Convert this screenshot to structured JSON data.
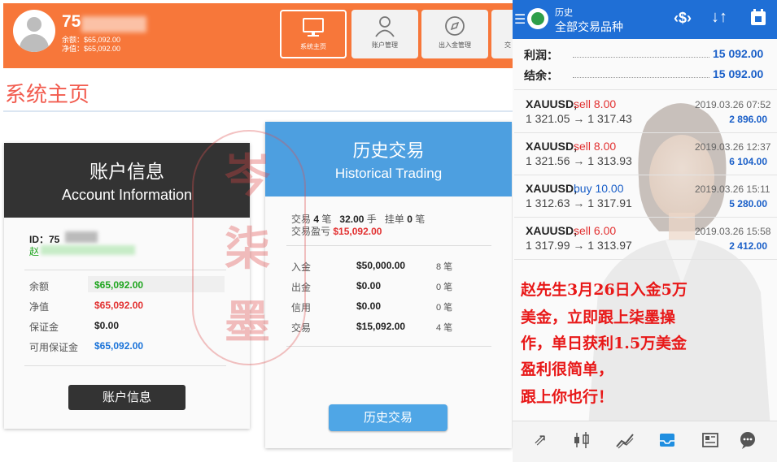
{
  "web": {
    "account": {
      "id_prefix": "75",
      "balance_line": "余额：$65,092.00",
      "equity_line": "净值：$65,092.00"
    },
    "nav": [
      {
        "label": "系统主页",
        "icon": "monitor-icon",
        "active": true
      },
      {
        "label": "账户管理",
        "icon": "user-icon",
        "active": false
      },
      {
        "label": "出入金管理",
        "icon": "compass-icon",
        "active": false
      },
      {
        "label": "交",
        "icon": "list-icon",
        "active": false
      }
    ],
    "page_title": "系统主页",
    "account_card": {
      "title_zh": "账户信息",
      "title_en": "Account Information",
      "id_label": "ID：75",
      "name_prefix": "赵",
      "rows": [
        {
          "label": "余额",
          "value": "$65,092.00",
          "color": "#1fa51f"
        },
        {
          "label": "净值",
          "value": "$65,092.00",
          "color": "#e23030"
        },
        {
          "label": "保证金",
          "value": "$0.00",
          "color": "#222222"
        },
        {
          "label": "可用保证金",
          "value": "$65,092.00",
          "color": "#1a73d9"
        }
      ],
      "button": "账户信息"
    },
    "history_card": {
      "title_zh": "历史交易",
      "title_en": "Historical Trading",
      "summary": {
        "trades_label": "交易",
        "trades_value": "4",
        "trades_unit": "笔",
        "lots_value": "32.00",
        "lots_unit": "手",
        "pending_label": "挂单",
        "pending_value": "0",
        "pending_unit": "笔",
        "pl_label": "交易盈亏",
        "pl_value": "$15,092.00"
      },
      "rows": [
        {
          "label": "入金",
          "value": "$50,000.00",
          "count": "8 笔"
        },
        {
          "label": "出金",
          "value": "$0.00",
          "count": "0 笔"
        },
        {
          "label": "信用",
          "value": "$0.00",
          "count": "0 笔"
        },
        {
          "label": "交易",
          "value": "$15,092.00",
          "count": "4 笔"
        }
      ],
      "button": "历史交易"
    },
    "stamp_text": [
      "岑",
      "柒",
      "墨"
    ]
  },
  "mobile": {
    "header": {
      "title": "历史",
      "subtitle": "全部交易品种"
    },
    "summary": [
      {
        "label": "利润：",
        "value": "15 092.00"
      },
      {
        "label": "结余：",
        "value": "15 092.00"
      }
    ],
    "trades": [
      {
        "symbol": "XAUUSD,",
        "side": "sell 8.00",
        "side_color": "#e23030",
        "prices": "1 321.05 → 1 317.43",
        "date": "2019.03.26 07:52",
        "pl": "2 896.00"
      },
      {
        "symbol": "XAUUSD,",
        "side": "sell 8.00",
        "side_color": "#e23030",
        "prices": "1 321.56 → 1 313.93",
        "date": "2019.03.26 12:37",
        "pl": "6 104.00"
      },
      {
        "symbol": "XAUUSD,",
        "side": "buy 10.00",
        "side_color": "#1a5fc8",
        "prices": "1 312.63 → 1 317.91",
        "date": "2019.03.26 15:11",
        "pl": "5 280.00"
      },
      {
        "symbol": "XAUUSD,",
        "side": "sell 6.00",
        "side_color": "#e23030",
        "prices": "1 317.99 → 1 313.97",
        "date": "2019.03.26 15:58",
        "pl": "2 412.00"
      }
    ],
    "promo_lines": [
      "赵先生3月26日入金5万",
      "美金，立即跟上柒墨操",
      "作，单日获利1.5万美金",
      "盈利很简单，",
      "跟上你也行！"
    ],
    "bottom_icons": [
      "trade-arrows-icon",
      "candlestick-icon",
      "chart-line-icon",
      "inbox-icon",
      "news-icon",
      "chat-icon"
    ]
  },
  "colors": {
    "orange": "#f7773a",
    "dark_header": "#333333",
    "blue_header": "#4d9fe0",
    "mobile_blue": "#1f6fd6",
    "promo_red": "#e81818"
  }
}
